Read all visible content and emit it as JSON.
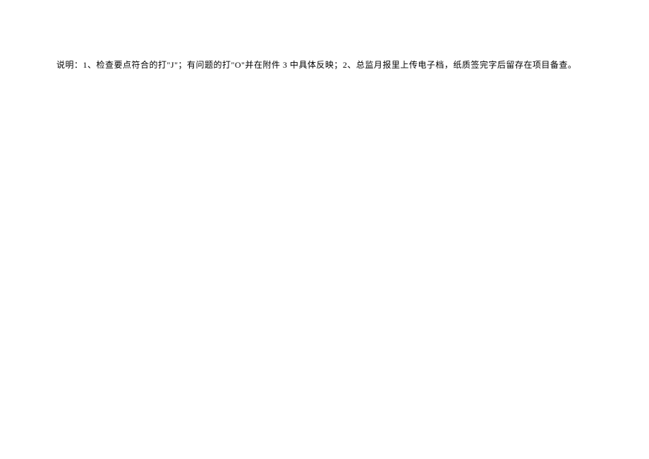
{
  "document": {
    "instruction_text": "说明：1、检查要点符合的打\"J\"；有问题的打\"O\"并在附件 3 中具体反映；2、总监月报里上传电子档，纸质签完字后留存在项目备查。"
  }
}
